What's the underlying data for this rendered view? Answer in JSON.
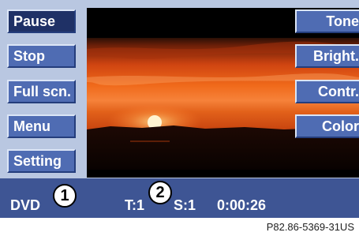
{
  "left_menu": [
    {
      "label": "Pause",
      "state": "active"
    },
    {
      "label": "Stop",
      "state": "normal"
    },
    {
      "label": "Full scn.",
      "state": "normal"
    },
    {
      "label": "Menu",
      "state": "normal"
    },
    {
      "label": "Setting",
      "state": "normal"
    }
  ],
  "right_menu": [
    {
      "label": "Tone"
    },
    {
      "label": "Bright."
    },
    {
      "label": "Contr."
    },
    {
      "label": "Color"
    }
  ],
  "status": {
    "source": "DVD",
    "track": "T:1",
    "scene": "S:1",
    "time": "0:00:26"
  },
  "callouts": [
    "1",
    "2"
  ],
  "figure_ref": "P82.86-5369-31US",
  "colors": {
    "button": "#4f6cb3",
    "button_active": "#1f3166",
    "status_bar": "#3e5594",
    "screen_bg": "#b9c7e1"
  }
}
